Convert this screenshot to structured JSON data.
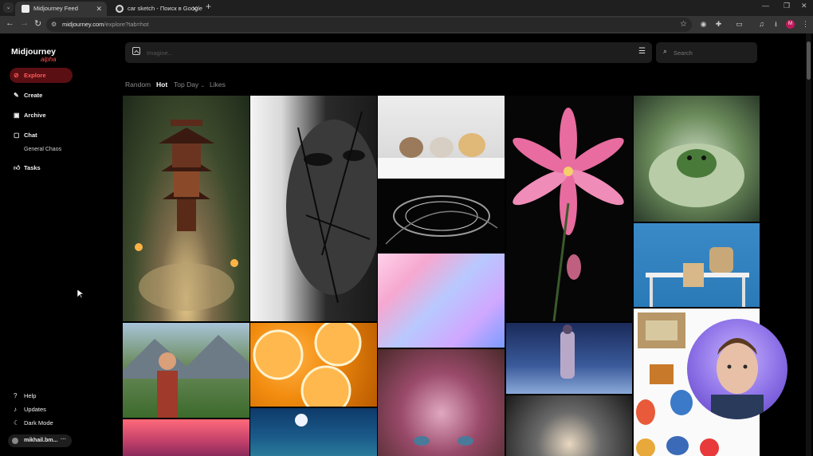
{
  "browser": {
    "tabs": [
      {
        "title": "Midjourney Feed",
        "active": true
      },
      {
        "title": "car sketch - Поиск в Google",
        "active": false
      }
    ],
    "address": {
      "host": "midjourney.com",
      "path": "/explore?tab=hot"
    },
    "profile_initial": "M"
  },
  "sidebar": {
    "logo": "Midjourney",
    "logo_badge": "alpha",
    "items": [
      {
        "label": "Explore",
        "icon": "compass-icon",
        "active": true
      },
      {
        "label": "Create",
        "icon": "brush-icon"
      },
      {
        "label": "Archive",
        "icon": "image-icon"
      },
      {
        "label": "Chat",
        "icon": "chat-icon"
      },
      {
        "label": "General Chaos",
        "sub": true
      },
      {
        "label": "Tasks",
        "icon": "thumbs-up-icon"
      }
    ],
    "footer": [
      {
        "label": "Help",
        "icon": "question-icon"
      },
      {
        "label": "Updates",
        "icon": "bell-icon"
      },
      {
        "label": "Dark Mode",
        "icon": "moon-icon"
      }
    ],
    "user": "mikhail.bm..."
  },
  "prompt": {
    "placeholder": "Imagine..."
  },
  "search": {
    "placeholder": "Search"
  },
  "feed_tabs": [
    {
      "label": "Random",
      "active": false
    },
    {
      "label": "Hot",
      "active": true
    },
    {
      "label": "Top Day",
      "active": false,
      "dropdown": true
    },
    {
      "label": "Likes",
      "active": false
    }
  ],
  "accent": "#ff4e4e"
}
